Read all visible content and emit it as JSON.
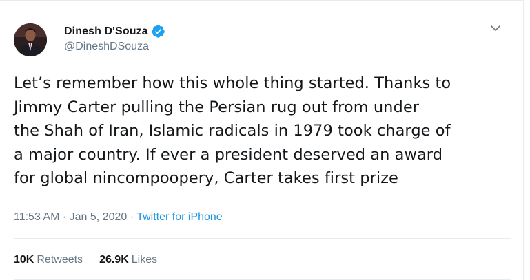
{
  "author": {
    "display_name": "Dinesh D'Souza",
    "handle": "@DineshDSouza",
    "verified_icon": "verified-badge-icon"
  },
  "tweet": {
    "lines": [
      "Let’s remember how this whole thing started. Thanks to",
      "Jimmy Carter pulling the Persian rug out from under",
      "the Shah of Iran, Islamic radicals in 1979 took charge of",
      "a major country. If ever a president deserved an award",
      "for global nincompoopery, Carter takes first prize"
    ]
  },
  "meta": {
    "time": "11:53 AM",
    "separator": " · ",
    "date": "Jan 5, 2020",
    "source": "Twitter for iPhone"
  },
  "stats": {
    "retweets_count": "10K",
    "retweets_label": "Retweets",
    "likes_count": "26.9K",
    "likes_label": "Likes"
  },
  "colors": {
    "accent": "#1b95e0",
    "muted": "#657786",
    "text": "#14171a",
    "border": "#e6ecf0"
  }
}
